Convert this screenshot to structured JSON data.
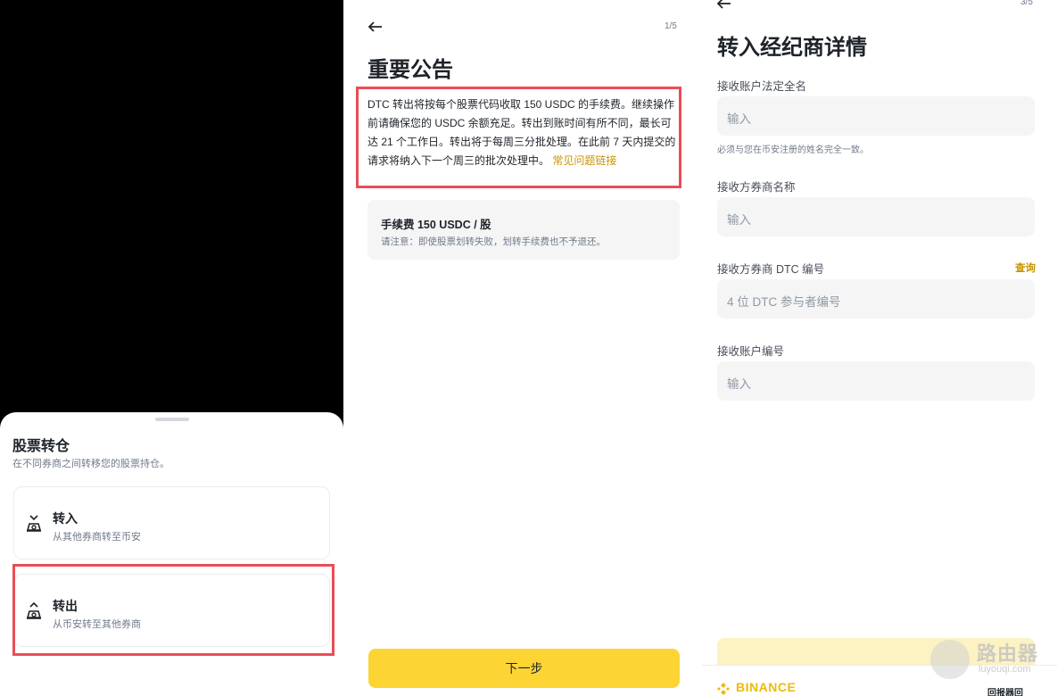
{
  "panel1": {
    "title": "股票转仓",
    "subtitle": "在不同券商之间转移您的股票持仓。",
    "options": [
      {
        "label": "转入",
        "desc": "从其他券商转至币安",
        "icon": "transfer-in-icon"
      },
      {
        "label": "转出",
        "desc": "从币安转至其他券商",
        "icon": "transfer-out-icon"
      }
    ]
  },
  "panel2": {
    "step": "1/5",
    "title": "重要公告",
    "announcement": "DTC 转出将按每个股票代码收取 150 USDC 的手续费。继续操作前请确保您的 USDC 余额充足。转出到账时间有所不同，最长可达 21 个工作日。转出将于每周三分批处理。在此前 7 天内提交的请求将纳入下一个周三的批次处理中。",
    "faq_link": "常见问题链接",
    "fee_title": "手续费 150 USDC / 股",
    "fee_note": "请注意：即使股票划转失败，划转手续费也不予退还。",
    "next_label": "下一步"
  },
  "panel3": {
    "step": "3/5",
    "title": "转入经纪商详情",
    "fields": [
      {
        "label": "接收账户法定全名",
        "placeholder": "输入"
      },
      {
        "label": "接收方券商名称",
        "placeholder": "输入"
      },
      {
        "label": "接收方券商 DTC 编号",
        "placeholder": "4 位 DTC 参与者编号"
      },
      {
        "label": "接收账户编号",
        "placeholder": "输入"
      }
    ],
    "name_hint": "必须与您在币安注册的姓名完全一致。",
    "query_label": "查询",
    "brand": "BINANCE",
    "qr_label": "回报器回"
  },
  "watermark": {
    "title": "路由器",
    "url": "luyouqi.com"
  },
  "colors": {
    "accent": "#fcd535",
    "link": "#c99400",
    "highlight": "#ea4d57"
  }
}
